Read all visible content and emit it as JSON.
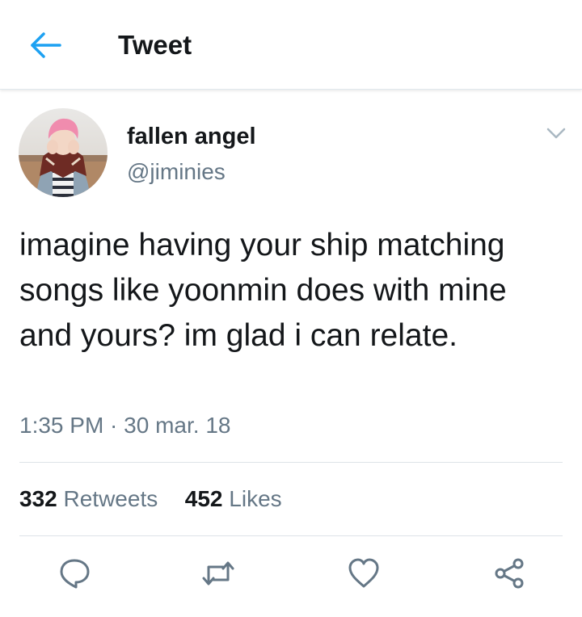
{
  "header": {
    "title": "Tweet",
    "back_icon": "arrow-left-icon",
    "accent_color": "#1da1f2"
  },
  "tweet": {
    "author": {
      "display_name": "fallen angel",
      "handle": "@jiminies",
      "avatar_icon": "profile-photo"
    },
    "text": "imagine having your ship matching songs like yoonmin does with mine and yours? im glad i can relate.",
    "timestamp": "1:35 PM · 30 mar. 18",
    "menu_icon": "chevron-down-icon"
  },
  "stats": {
    "retweets": {
      "count": "332",
      "label": "Retweets"
    },
    "likes": {
      "count": "452",
      "label": "Likes"
    }
  },
  "actions": [
    {
      "name": "reply",
      "icon": "reply-icon"
    },
    {
      "name": "retweet",
      "icon": "retweet-icon"
    },
    {
      "name": "like",
      "icon": "heart-icon"
    },
    {
      "name": "share",
      "icon": "share-icon"
    }
  ],
  "colors": {
    "text_primary": "#14171a",
    "text_secondary": "#657786",
    "icon_gray": "#657786",
    "divider": "#dde3e8"
  }
}
